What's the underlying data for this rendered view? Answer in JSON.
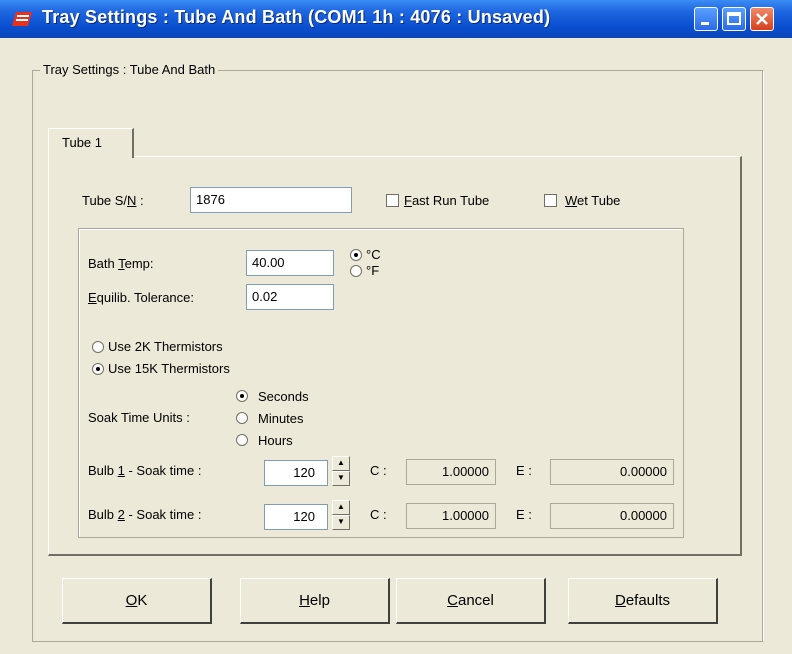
{
  "window": {
    "title": "Tray Settings : Tube And Bath (COM1 1h : 4076 : Unsaved)"
  },
  "group_title": "Tray Settings : Tube And Bath",
  "tab": {
    "label": "Tube 1"
  },
  "tube": {
    "sn_label_pre": "Tube S/",
    "sn_label_u": "N",
    "sn_label_post": " :",
    "sn_value": "1876",
    "fast_run_u": "F",
    "fast_run_rest": "ast Run Tube",
    "fast_run_checked": false,
    "wet_u": "W",
    "wet_rest": "et Tube",
    "wet_checked": false
  },
  "bath": {
    "temp_label_pre": "Bath ",
    "temp_label_u": "T",
    "temp_label_post": "emp:",
    "temp_value": "40.00",
    "unit_c": "°C",
    "unit_f": "°F",
    "unit_selected": "C",
    "tol_label_u": "E",
    "tol_label_rest": "quilib. Tolerance:",
    "tol_value": "0.02"
  },
  "thermistors": {
    "opt_2k": "Use 2K Thermistors",
    "opt_15k": "Use 15K Thermistors",
    "selected": "15K"
  },
  "soak_units": {
    "label": "Soak Time Units :",
    "seconds": "Seconds",
    "minutes": "Minutes",
    "hours": "Hours",
    "selected": "Seconds"
  },
  "bulbs": [
    {
      "label_pre": "Bulb ",
      "label_u": "1",
      "label_post": " - Soak time :",
      "soak": "120",
      "c_label": "C :",
      "c_value": "1.00000",
      "e_label": "E :",
      "e_value": "0.00000"
    },
    {
      "label_pre": "Bulb ",
      "label_u": "2",
      "label_post": " - Soak time :",
      "soak": "120",
      "c_label": "C :",
      "c_value": "1.00000",
      "e_label": "E :",
      "e_value": "0.00000"
    }
  ],
  "buttons": {
    "ok_u": "O",
    "ok_rest": "K",
    "help_u": "H",
    "help_rest": "elp",
    "cancel_u": "C",
    "cancel_rest": "ancel",
    "defaults_u": "D",
    "defaults_rest": "efaults"
  },
  "icons": {
    "app": "tray-app-icon",
    "minimize": "minimize-icon",
    "maximize": "maximize-icon",
    "close": "close-icon"
  }
}
